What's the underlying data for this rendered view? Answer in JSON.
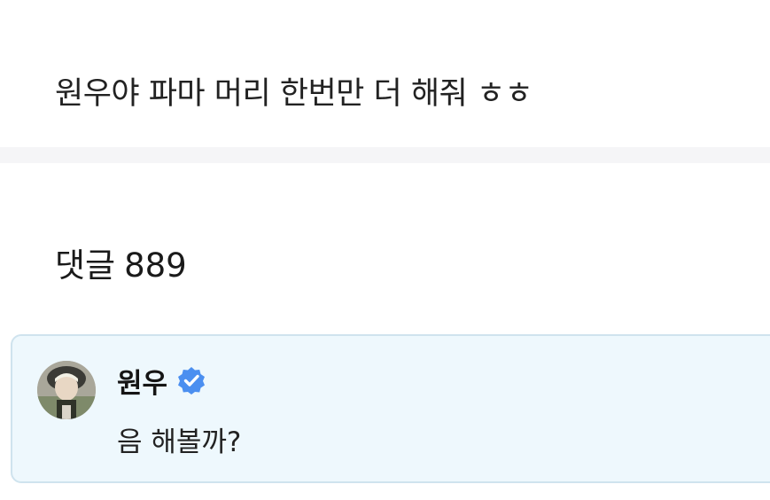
{
  "post": {
    "text": "원우야 파마 머리 한번만 더 해줘 ㅎㅎ"
  },
  "comments_section": {
    "label": "댓글",
    "count": "889"
  },
  "comment": {
    "author": "원우",
    "verified_icon": "verified-badge-icon",
    "text": "음 해볼까?"
  },
  "colors": {
    "card_background": "#eef8fd",
    "card_border": "#cfe3ee",
    "verified_badge": "#4b8ff0",
    "divider": "#f5f5f7"
  }
}
